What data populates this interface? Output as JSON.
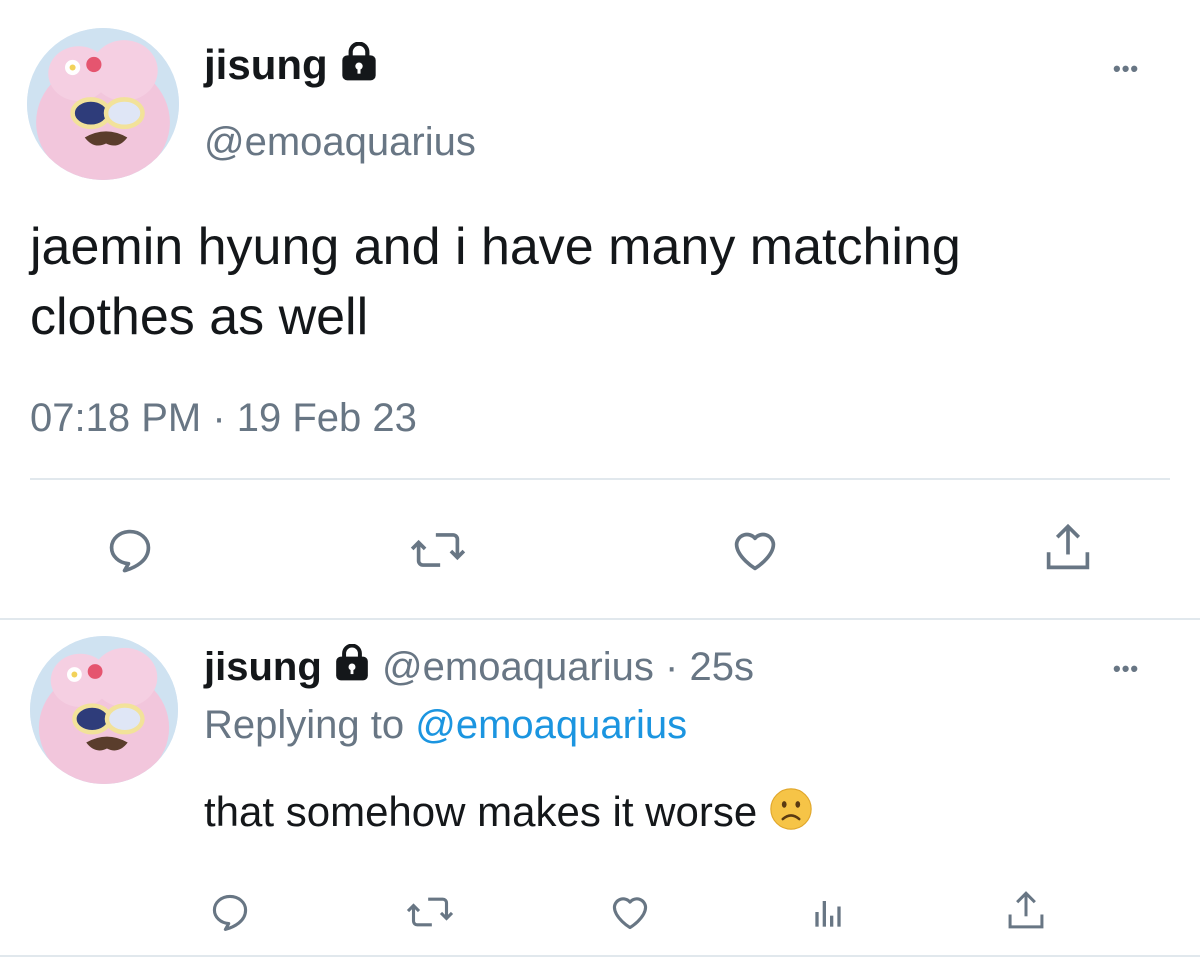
{
  "main_tweet": {
    "display_name": "jisung",
    "handle": "@emoaquarius",
    "text_line1": "jaemin hyung and i have many matching",
    "text_line2": "clothes as well",
    "timestamp": "07:18 PM · 19 Feb 23",
    "more_label": "•••",
    "icons": [
      "reply-icon",
      "retweet-icon",
      "like-icon",
      "share-icon"
    ]
  },
  "reply_tweet": {
    "display_name": "jisung",
    "handle": "@emoaquarius",
    "separator": "·",
    "age": "25s",
    "replying_prefix": "Replying to",
    "replying_handle": "@emoaquarius",
    "text": "that somehow makes it worse",
    "emoji": "slightly-frowning-face",
    "more_label": "•••",
    "icons": [
      "reply-icon",
      "retweet-icon",
      "like-icon",
      "analytics-icon",
      "share-icon"
    ]
  },
  "colors": {
    "text": "#14171a",
    "secondary": "#687684",
    "link": "#1b95e0",
    "divider": "#e1e8ed"
  }
}
